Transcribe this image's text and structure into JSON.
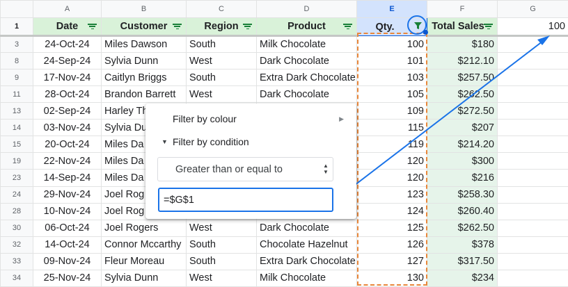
{
  "columns": {
    "a": "A",
    "b": "B",
    "c": "C",
    "d": "D",
    "e": "E",
    "f": "F",
    "g": "G"
  },
  "header_row": {
    "row_number": "1",
    "date": "Date",
    "customer": "Customer",
    "region": "Region",
    "product": "Product",
    "qty": "Qty.",
    "total_sales": "Total Sales",
    "g1_value": "100"
  },
  "rows": [
    {
      "row": "3",
      "date": "24-Oct-24",
      "customer": "Miles Dawson",
      "region": "South",
      "product": "Milk Chocolate",
      "qty": "100",
      "total": "$180"
    },
    {
      "row": "8",
      "date": "24-Sep-24",
      "customer": "Sylvia Dunn",
      "region": "West",
      "product": "Dark Chocolate",
      "qty": "101",
      "total": "$212.10"
    },
    {
      "row": "9",
      "date": "17-Nov-24",
      "customer": "Caitlyn Briggs",
      "region": "South",
      "product": "Extra Dark Chocolate",
      "qty": "103",
      "total": "$257.50"
    },
    {
      "row": "11",
      "date": "28-Oct-24",
      "customer": "Brandon Barrett",
      "region": "West",
      "product": "Dark Chocolate",
      "qty": "105",
      "total": "$262.50"
    },
    {
      "row": "13",
      "date": "02-Sep-24",
      "customer": "Harley Th",
      "region": "",
      "product": "",
      "qty": "109",
      "total": "$272.50"
    },
    {
      "row": "14",
      "date": "03-Nov-24",
      "customer": "Sylvia Du",
      "region": "",
      "product": "",
      "qty": "115",
      "total": "$207"
    },
    {
      "row": "15",
      "date": "20-Oct-24",
      "customer": "Miles Da",
      "region": "",
      "product": "",
      "qty": "119",
      "total": "$214.20"
    },
    {
      "row": "19",
      "date": "22-Nov-24",
      "customer": "Miles Da",
      "region": "",
      "product": "",
      "qty": "120",
      "total": "$300"
    },
    {
      "row": "23",
      "date": "14-Sep-24",
      "customer": "Miles Da",
      "region": "",
      "product": "",
      "qty": "120",
      "total": "$216"
    },
    {
      "row": "24",
      "date": "29-Nov-24",
      "customer": "Joel Rog",
      "region": "",
      "product": "",
      "qty": "123",
      "total": "$258.30"
    },
    {
      "row": "28",
      "date": "10-Nov-24",
      "customer": "Joel Rog",
      "region": "",
      "product": "",
      "qty": "124",
      "total": "$260.40"
    },
    {
      "row": "30",
      "date": "06-Oct-24",
      "customer": "Joel Rogers",
      "region": "West",
      "product": "Dark Chocolate",
      "qty": "125",
      "total": "$262.50"
    },
    {
      "row": "32",
      "date": "14-Oct-24",
      "customer": "Connor Mccarthy",
      "region": "South",
      "product": "Chocolate Hazelnut",
      "qty": "126",
      "total": "$378"
    },
    {
      "row": "33",
      "date": "09-Nov-24",
      "customer": "Fleur Moreau",
      "region": "South",
      "product": "Extra Dark Chocolate",
      "qty": "127",
      "total": "$317.50"
    },
    {
      "row": "34",
      "date": "25-Nov-24",
      "customer": "Sylvia Dunn",
      "region": "West",
      "product": "Milk Chocolate",
      "qty": "130",
      "total": "$234"
    }
  ],
  "filter_menu": {
    "filter_by_colour": "Filter by colour",
    "filter_by_condition": "Filter by condition",
    "condition": "Greater than or equal to",
    "condition_value": "=$G$1"
  },
  "icons": {
    "column_filter": "filter-icon",
    "active_filter": "filter-funnel-icon",
    "submenu_arrow": "chevron-right-icon",
    "section_caret": "caret-down-icon",
    "select_arrows": "up-down-arrows-icon"
  },
  "colors": {
    "header_green": "#d9f2d9",
    "total_column_green": "#e6f4ea",
    "selection_blue": "#d3e3fd",
    "highlight_orange": "#e8873b",
    "annotation_blue": "#1a73e8"
  }
}
